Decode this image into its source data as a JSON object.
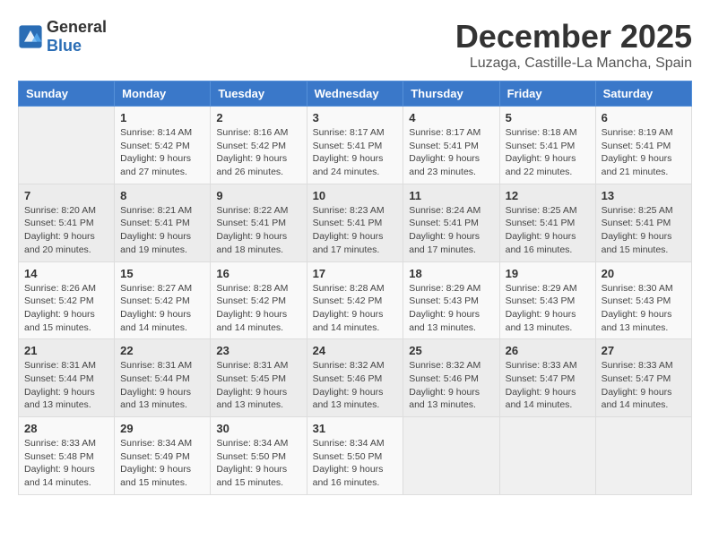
{
  "logo": {
    "general": "General",
    "blue": "Blue"
  },
  "title": "December 2025",
  "location": "Luzaga, Castille-La Mancha, Spain",
  "days_of_week": [
    "Sunday",
    "Monday",
    "Tuesday",
    "Wednesday",
    "Thursday",
    "Friday",
    "Saturday"
  ],
  "weeks": [
    [
      {
        "day": "",
        "info": ""
      },
      {
        "day": "1",
        "info": "Sunrise: 8:14 AM\nSunset: 5:42 PM\nDaylight: 9 hours\nand 27 minutes."
      },
      {
        "day": "2",
        "info": "Sunrise: 8:16 AM\nSunset: 5:42 PM\nDaylight: 9 hours\nand 26 minutes."
      },
      {
        "day": "3",
        "info": "Sunrise: 8:17 AM\nSunset: 5:41 PM\nDaylight: 9 hours\nand 24 minutes."
      },
      {
        "day": "4",
        "info": "Sunrise: 8:17 AM\nSunset: 5:41 PM\nDaylight: 9 hours\nand 23 minutes."
      },
      {
        "day": "5",
        "info": "Sunrise: 8:18 AM\nSunset: 5:41 PM\nDaylight: 9 hours\nand 22 minutes."
      },
      {
        "day": "6",
        "info": "Sunrise: 8:19 AM\nSunset: 5:41 PM\nDaylight: 9 hours\nand 21 minutes."
      }
    ],
    [
      {
        "day": "7",
        "info": "Sunrise: 8:20 AM\nSunset: 5:41 PM\nDaylight: 9 hours\nand 20 minutes."
      },
      {
        "day": "8",
        "info": "Sunrise: 8:21 AM\nSunset: 5:41 PM\nDaylight: 9 hours\nand 19 minutes."
      },
      {
        "day": "9",
        "info": "Sunrise: 8:22 AM\nSunset: 5:41 PM\nDaylight: 9 hours\nand 18 minutes."
      },
      {
        "day": "10",
        "info": "Sunrise: 8:23 AM\nSunset: 5:41 PM\nDaylight: 9 hours\nand 17 minutes."
      },
      {
        "day": "11",
        "info": "Sunrise: 8:24 AM\nSunset: 5:41 PM\nDaylight: 9 hours\nand 17 minutes."
      },
      {
        "day": "12",
        "info": "Sunrise: 8:25 AM\nSunset: 5:41 PM\nDaylight: 9 hours\nand 16 minutes."
      },
      {
        "day": "13",
        "info": "Sunrise: 8:25 AM\nSunset: 5:41 PM\nDaylight: 9 hours\nand 15 minutes."
      }
    ],
    [
      {
        "day": "14",
        "info": "Sunrise: 8:26 AM\nSunset: 5:42 PM\nDaylight: 9 hours\nand 15 minutes."
      },
      {
        "day": "15",
        "info": "Sunrise: 8:27 AM\nSunset: 5:42 PM\nDaylight: 9 hours\nand 14 minutes."
      },
      {
        "day": "16",
        "info": "Sunrise: 8:28 AM\nSunset: 5:42 PM\nDaylight: 9 hours\nand 14 minutes."
      },
      {
        "day": "17",
        "info": "Sunrise: 8:28 AM\nSunset: 5:42 PM\nDaylight: 9 hours\nand 14 minutes."
      },
      {
        "day": "18",
        "info": "Sunrise: 8:29 AM\nSunset: 5:43 PM\nDaylight: 9 hours\nand 13 minutes."
      },
      {
        "day": "19",
        "info": "Sunrise: 8:29 AM\nSunset: 5:43 PM\nDaylight: 9 hours\nand 13 minutes."
      },
      {
        "day": "20",
        "info": "Sunrise: 8:30 AM\nSunset: 5:43 PM\nDaylight: 9 hours\nand 13 minutes."
      }
    ],
    [
      {
        "day": "21",
        "info": "Sunrise: 8:31 AM\nSunset: 5:44 PM\nDaylight: 9 hours\nand 13 minutes."
      },
      {
        "day": "22",
        "info": "Sunrise: 8:31 AM\nSunset: 5:44 PM\nDaylight: 9 hours\nand 13 minutes."
      },
      {
        "day": "23",
        "info": "Sunrise: 8:31 AM\nSunset: 5:45 PM\nDaylight: 9 hours\nand 13 minutes."
      },
      {
        "day": "24",
        "info": "Sunrise: 8:32 AM\nSunset: 5:46 PM\nDaylight: 9 hours\nand 13 minutes."
      },
      {
        "day": "25",
        "info": "Sunrise: 8:32 AM\nSunset: 5:46 PM\nDaylight: 9 hours\nand 13 minutes."
      },
      {
        "day": "26",
        "info": "Sunrise: 8:33 AM\nSunset: 5:47 PM\nDaylight: 9 hours\nand 14 minutes."
      },
      {
        "day": "27",
        "info": "Sunrise: 8:33 AM\nSunset: 5:47 PM\nDaylight: 9 hours\nand 14 minutes."
      }
    ],
    [
      {
        "day": "28",
        "info": "Sunrise: 8:33 AM\nSunset: 5:48 PM\nDaylight: 9 hours\nand 14 minutes."
      },
      {
        "day": "29",
        "info": "Sunrise: 8:34 AM\nSunset: 5:49 PM\nDaylight: 9 hours\nand 15 minutes."
      },
      {
        "day": "30",
        "info": "Sunrise: 8:34 AM\nSunset: 5:50 PM\nDaylight: 9 hours\nand 15 minutes."
      },
      {
        "day": "31",
        "info": "Sunrise: 8:34 AM\nSunset: 5:50 PM\nDaylight: 9 hours\nand 16 minutes."
      },
      {
        "day": "",
        "info": ""
      },
      {
        "day": "",
        "info": ""
      },
      {
        "day": "",
        "info": ""
      }
    ]
  ]
}
